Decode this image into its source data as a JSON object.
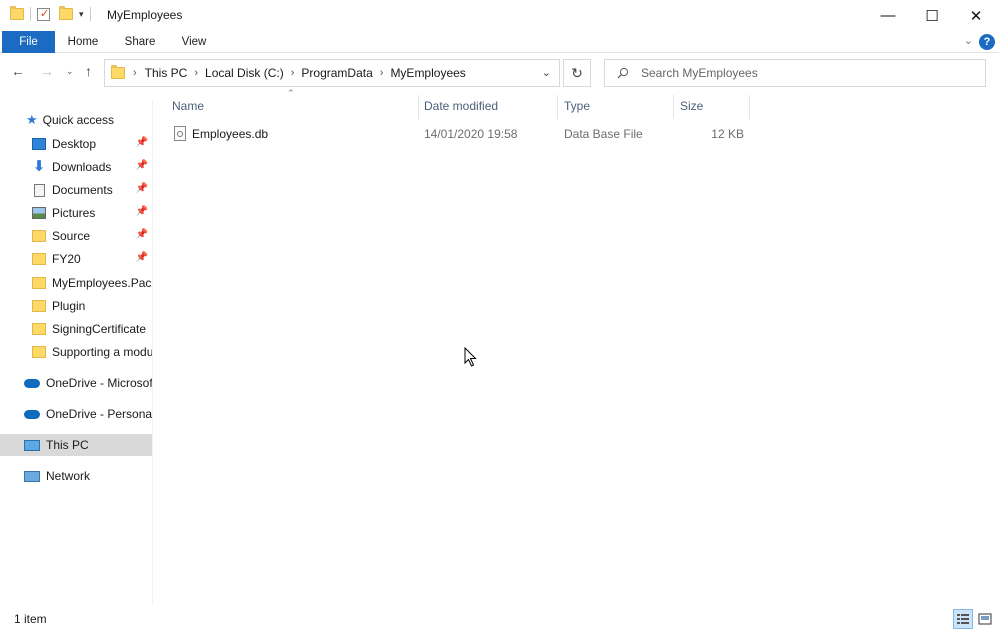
{
  "window": {
    "title": "MyEmployees",
    "quick_access_toolbar": [
      "folder-icon",
      "properties-icon",
      "new-folder-icon",
      "customize-chevron-icon"
    ],
    "controls": {
      "minimize": "—",
      "maximize": "☐",
      "close": "✕"
    }
  },
  "ribbon": {
    "tabs": [
      "File",
      "Home",
      "Share",
      "View"
    ],
    "active_tab": "File",
    "colors": {
      "file_tab": "#1a6bc1",
      "help": "#1a6bc1"
    }
  },
  "address_bar": {
    "breadcrumbs": [
      "This PC",
      "Local Disk (C:)",
      "ProgramData",
      "MyEmployees"
    ],
    "dropdown_icon": "chevron-down-icon",
    "refresh_icon": "refresh-icon"
  },
  "search": {
    "placeholder": "Search MyEmployees"
  },
  "nav_pane": {
    "quick_access": "Quick access",
    "items": [
      {
        "label": "Desktop",
        "icon": "desktop-icon",
        "pinned": true
      },
      {
        "label": "Downloads",
        "icon": "download-arrow-icon",
        "pinned": true
      },
      {
        "label": "Documents",
        "icon": "documents-icon",
        "pinned": true
      },
      {
        "label": "Pictures",
        "icon": "pictures-icon",
        "pinned": true
      },
      {
        "label": "Source",
        "icon": "folder-icon",
        "pinned": true
      },
      {
        "label": "FY20",
        "icon": "folder-icon",
        "pinned": true
      },
      {
        "label": "MyEmployees.Pack",
        "icon": "folder-icon",
        "pinned": false
      },
      {
        "label": "Plugin",
        "icon": "folder-icon",
        "pinned": false
      },
      {
        "label": "SigningCertificate",
        "icon": "folder-icon",
        "pinned": false
      },
      {
        "label": "Supporting a modu",
        "icon": "folder-icon",
        "pinned": false
      }
    ],
    "onedrive_business": "OneDrive - Microsoft",
    "onedrive_personal": "OneDrive - Personal",
    "this_pc": "This PC",
    "network": "Network",
    "selected": "This PC"
  },
  "file_list": {
    "columns": [
      "Name",
      "Date modified",
      "Type",
      "Size"
    ],
    "sort_column": "Name",
    "rows": [
      {
        "name": "Employees.db",
        "date_modified": "14/01/2020 19:58",
        "type": "Data Base File",
        "size": "12 KB",
        "icon": "database-file-icon"
      }
    ]
  },
  "status_bar": {
    "item_count": "1 item",
    "views": [
      "details-view-icon",
      "large-icons-view-icon"
    ],
    "active_view": "details-view-icon"
  }
}
